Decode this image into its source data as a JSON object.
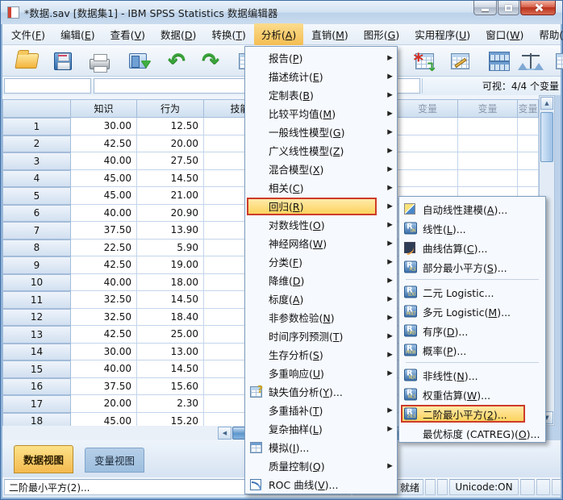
{
  "window": {
    "title": "*数据.sav [数据集1] - IBM SPSS Statistics 数据编辑器"
  },
  "menu_bar": {
    "items": [
      "文件(F)",
      "编辑(E)",
      "查看(V)",
      "数据(D)",
      "转换(T)",
      "分析(A)",
      "直销(M)",
      "图形(G)",
      "实用程序(U)",
      "窗口(W)",
      "帮助(H)"
    ],
    "highlighted": "分析(A)"
  },
  "toolbar": {
    "icons": [
      "open-file",
      "save",
      "print",
      "recall-dialogs",
      "undo",
      "redo",
      "insert-variable",
      "insert-cases",
      "variables",
      "split-file",
      "weight-cases",
      "value-labels"
    ]
  },
  "cell_ref_bar": {
    "reference_value": "",
    "editor_value": "",
    "visible_label": "可视：4/4 个变量"
  },
  "grid": {
    "columns": [
      "知识",
      "行为",
      "技能",
      "",
      "",
      "变量",
      "变量",
      "变量"
    ],
    "rows": [
      {
        "num": "1",
        "values": [
          "30.00",
          "12.50"
        ]
      },
      {
        "num": "2",
        "values": [
          "42.50",
          "20.00"
        ]
      },
      {
        "num": "3",
        "values": [
          "40.00",
          "27.50"
        ]
      },
      {
        "num": "4",
        "values": [
          "45.00",
          "14.50"
        ]
      },
      {
        "num": "5",
        "values": [
          "45.00",
          "21.00"
        ]
      },
      {
        "num": "6",
        "values": [
          "40.00",
          "20.90"
        ]
      },
      {
        "num": "7",
        "values": [
          "37.50",
          "13.90"
        ]
      },
      {
        "num": "8",
        "values": [
          "22.50",
          "5.90"
        ]
      },
      {
        "num": "9",
        "values": [
          "42.50",
          "19.00"
        ]
      },
      {
        "num": "10",
        "values": [
          "40.00",
          "18.00"
        ]
      },
      {
        "num": "11",
        "values": [
          "32.50",
          "14.50"
        ]
      },
      {
        "num": "12",
        "values": [
          "32.50",
          "18.40"
        ]
      },
      {
        "num": "13",
        "values": [
          "42.50",
          "25.00"
        ]
      },
      {
        "num": "14",
        "values": [
          "30.00",
          "13.00"
        ]
      },
      {
        "num": "15",
        "values": [
          "40.00",
          "14.50"
        ]
      },
      {
        "num": "16",
        "values": [
          "37.50",
          "15.60"
        ]
      },
      {
        "num": "17",
        "values": [
          "20.00",
          "2.30"
        ]
      },
      {
        "num": "18",
        "values": [
          "45.00",
          "15.20"
        ]
      }
    ]
  },
  "analyze_menu": {
    "items": [
      {
        "label": "报告(P)",
        "arrow": true
      },
      {
        "label": "描述统计(E)",
        "arrow": true
      },
      {
        "label": "定制表(B)",
        "arrow": true
      },
      {
        "label": "比较平均值(M)",
        "arrow": true
      },
      {
        "label": "一般线性模型(G)",
        "arrow": true
      },
      {
        "label": "广义线性模型(Z)",
        "arrow": true
      },
      {
        "label": "混合模型(X)",
        "arrow": true
      },
      {
        "label": "相关(C)",
        "arrow": true
      },
      {
        "label": "回归(R)",
        "arrow": true,
        "highlighted": true
      },
      {
        "label": "对数线性(O)",
        "arrow": true
      },
      {
        "label": "神经网络(W)",
        "arrow": true
      },
      {
        "label": "分类(F)",
        "arrow": true
      },
      {
        "label": "降维(D)",
        "arrow": true
      },
      {
        "label": "标度(A)",
        "arrow": true
      },
      {
        "label": "非参数检验(N)",
        "arrow": true
      },
      {
        "label": "时间序列预测(T)",
        "arrow": true
      },
      {
        "label": "生存分析(S)",
        "arrow": true
      },
      {
        "label": "多重响应(U)",
        "arrow": true
      },
      {
        "label": "缺失值分析(Y)...",
        "icon": "missing-values"
      },
      {
        "label": "多重插补(T)",
        "arrow": true
      },
      {
        "label": "复杂抽样(L)",
        "arrow": true
      },
      {
        "label": "模拟(I)...",
        "icon": "simulation"
      },
      {
        "label": "质量控制(Q)",
        "arrow": true
      },
      {
        "label": "ROC 曲线(V)...",
        "icon": "roc-curve"
      }
    ]
  },
  "regression_submenu": {
    "items": [
      {
        "label": "自动线性建模(A)...",
        "icon": "auto-linear"
      },
      {
        "label": "线性(L)...",
        "icon": "r-badge",
        "badge": "LIN"
      },
      {
        "label": "曲线估算(C)...",
        "icon": "curve-estimation"
      },
      {
        "label": "部分最小平方(S)...",
        "icon": "r-badge",
        "badge": "PLS",
        "separator_after": true
      },
      {
        "label": "二元 Logistic...",
        "icon": "r-badge",
        "badge": "LOG"
      },
      {
        "label": "多元 Logistic(M)...",
        "icon": "r-badge",
        "badge": "MULT"
      },
      {
        "label": "有序(D)...",
        "icon": "r-badge",
        "badge": "ORD"
      },
      {
        "label": "概率(P)...",
        "icon": "r-badge",
        "badge": "PROB",
        "separator_after": true
      },
      {
        "label": "非线性(N)...",
        "icon": "r-badge",
        "badge": "NLR"
      },
      {
        "label": "权重估算(W)...",
        "icon": "r-badge",
        "badge": "WLS"
      },
      {
        "label": "二阶最小平方(2)...",
        "icon": "r-badge",
        "badge": "2SLS",
        "highlighted": true
      },
      {
        "label": "最优标度 (CATREG)(O)..."
      }
    ]
  },
  "tabs": {
    "items": [
      "数据视图",
      "变量视图"
    ],
    "active": "数据视图"
  },
  "status_bar": {
    "message": "二阶最小平方(2)...",
    "ready": "就绪",
    "unicode": "Unicode:ON"
  },
  "icons": {
    "submenu_arrow": "▶",
    "scroll_up": "▲",
    "scroll_down": "▼",
    "scroll_left": "◀",
    "undo_arrow": "↶",
    "redo_arrow": "↷",
    "insert_cases_star": "*",
    "insert_cases_arrow": "↴"
  },
  "colors": {
    "highlight_box_red": "#cd3b2a",
    "highlight_fill_yellow": "#fbd35f",
    "menubar_highlight_orange": "#f4bd52",
    "active_tab_orange": "#f3b94e",
    "grid_line": "#c3d5ea",
    "header_blue": "#cfdff0"
  }
}
